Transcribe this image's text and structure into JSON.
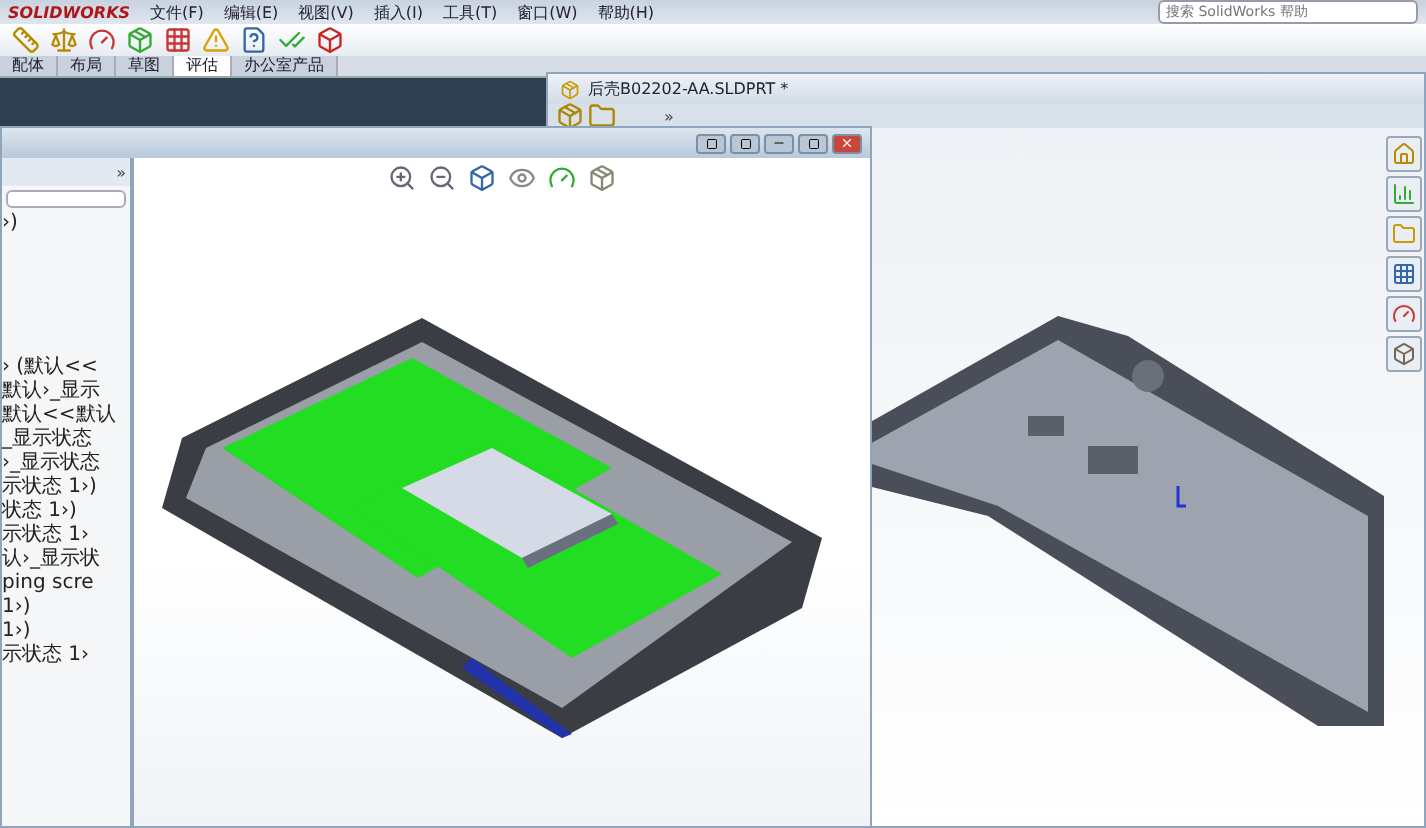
{
  "brand": "SOLIDWORKS",
  "menu": [
    "文件(F)",
    "编辑(E)",
    "视图(V)",
    "插入(I)",
    "工具(T)",
    "窗口(W)",
    "帮助(H)"
  ],
  "search": {
    "placeholder": "搜索 SolidWorks 帮助"
  },
  "tabs": [
    {
      "label": "配体",
      "selected": false
    },
    {
      "label": "布局",
      "selected": false
    },
    {
      "label": "草图",
      "selected": false
    },
    {
      "label": "评估",
      "selected": true
    },
    {
      "label": "办公室产品",
      "selected": false
    }
  ],
  "back_window": {
    "title": "后壳B02202-AA.SLDPRT *",
    "expand": "»"
  },
  "tree": {
    "expand": "»",
    "items": [
      "›)",
      "› (默认<<",
      "默认›_显示",
      "默认<<默认",
      "_显示状态",
      "›_显示状态",
      "示状态 1›)",
      "状态 1›)",
      "示状态 1›",
      "认›_显示状",
      "ping scre",
      "1›)",
      "1›)",
      "示状态 1›"
    ]
  }
}
